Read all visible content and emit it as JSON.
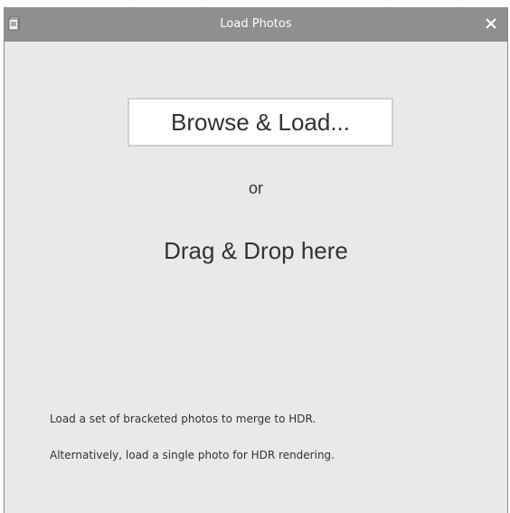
{
  "window": {
    "title": "Load Photos",
    "app_icon": "photo-stack-icon",
    "close_icon": "close-icon"
  },
  "main": {
    "browse_label": "Browse & Load...",
    "or_text": "or",
    "drag_drop_text": "Drag & Drop here",
    "help_lines": [
      "Load a set of bracketed photos to merge to HDR.",
      "Alternatively, load a single photo for HDR rendering."
    ]
  },
  "colors": {
    "titlebar": "#8f8f8f",
    "background": "#e9e9eb",
    "button_background": "#ffffff",
    "text": "#333333"
  }
}
